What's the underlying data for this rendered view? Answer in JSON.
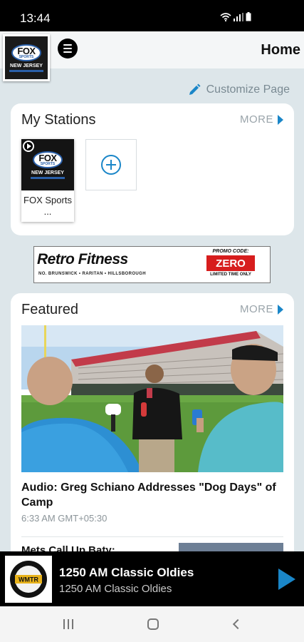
{
  "status": {
    "time": "13:44"
  },
  "header": {
    "title": "Home",
    "logo_text": "FOX SPORTS NEW JERSEY"
  },
  "customize": {
    "label": "Customize Page"
  },
  "my_stations": {
    "title": "My Stations",
    "more_label": "MORE",
    "stations": [
      {
        "name": "FOX Sports ..."
      }
    ]
  },
  "ad": {
    "brand": "Retro Fitness",
    "locations": "NO. BRUNSWICK • RARITAN • HILLSBOROUGH",
    "promo_label": "PROMO CODE:",
    "promo_code": "ZERO",
    "promo_note": "LIMITED TIME ONLY"
  },
  "featured": {
    "title": "Featured",
    "more_label": "MORE",
    "items": [
      {
        "headline": "Audio: Greg Schiano Addresses \"Dog Days\" of Camp",
        "time": "6:33 AM GMT+05:30"
      },
      {
        "headline": "Mets Call Up Baty:"
      }
    ]
  },
  "now_playing": {
    "title": "1250 AM Classic Oldies",
    "subtitle": "1250 AM Classic Oldies",
    "logo_text": "WMTR"
  },
  "colors": {
    "accent": "#1a86c8",
    "background": "#dde6ea"
  }
}
